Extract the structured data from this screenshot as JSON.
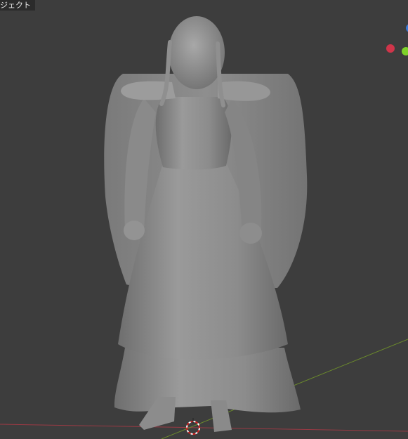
{
  "viewport": {
    "mode_label": "ジェクト",
    "background": "#3d3d3d",
    "model_color": "#8a8a8a"
  },
  "gizmo": {
    "x_axis_color": "#d0354a",
    "y_axis_color": "#7fd22a",
    "z_axis_color": "#3a7ad8"
  },
  "grid": {
    "x_axis_color": "#9a3a44",
    "y_axis_color": "#6b8a2c"
  },
  "cursor": {
    "icon": "3d-cursor-icon"
  },
  "model": {
    "icon": "figure-mesh"
  }
}
